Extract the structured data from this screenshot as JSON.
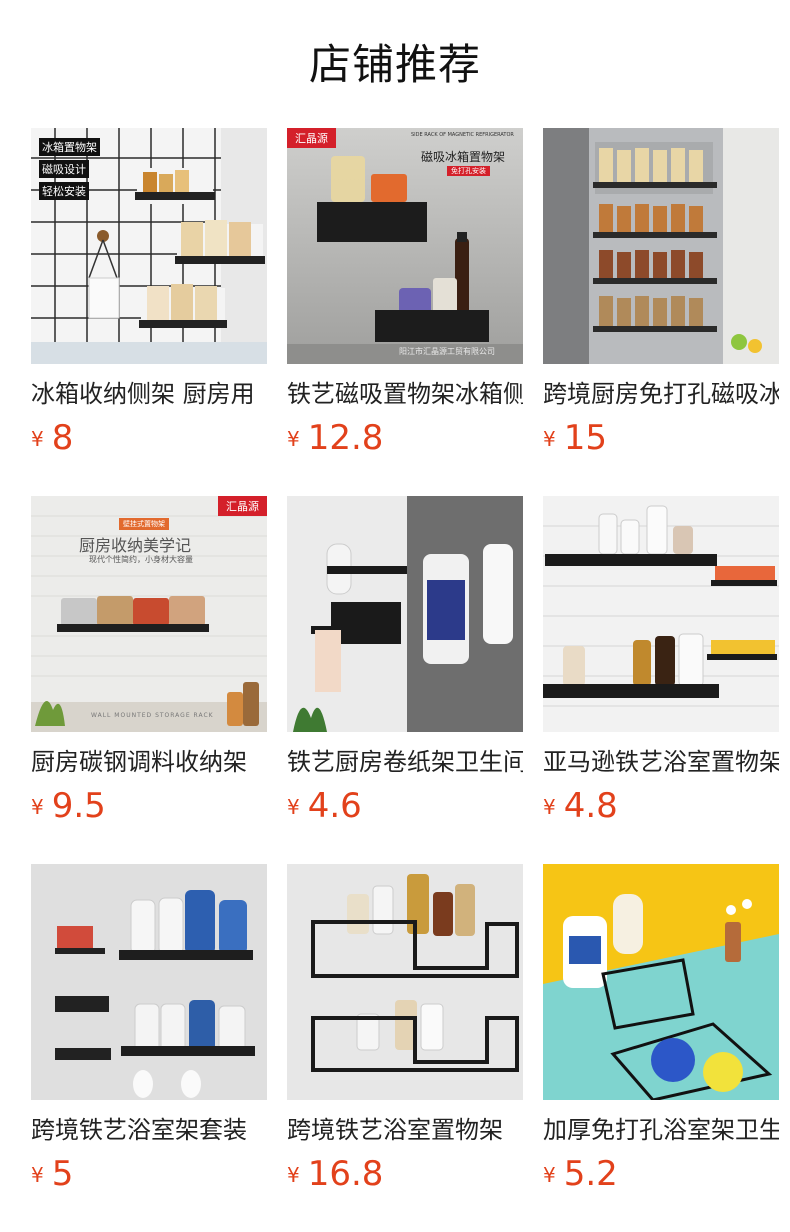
{
  "title": "店铺推荐",
  "currency": "¥",
  "products": [
    {
      "name": "冰箱收纳侧架 厨房用",
      "price": "8",
      "image_texts": [
        "冰箱置物架",
        "磁吸设计",
        "轻松安装"
      ]
    },
    {
      "name": "铁艺磁吸置物架冰箱侧",
      "price": "12.8",
      "badge": "汇晶源",
      "image_texts": [
        "SIDE RACK OF MAGNETIC REFRIGERATOR",
        "磁吸冰箱置物架",
        "免打孔安装",
        "阳江市汇晶源工贸有限公司"
      ]
    },
    {
      "name": "跨境厨房免打孔磁吸冰",
      "price": "15"
    },
    {
      "name": "厨房碳钢调料收纳架",
      "price": "9.5",
      "badge": "汇晶源",
      "image_texts": [
        "壁挂式置物架",
        "厨房收纳美学记",
        "现代个性简约，小身材大容量",
        "WALL MOUNTED STORAGE RACK"
      ]
    },
    {
      "name": "铁艺厨房卷纸架卫生间",
      "price": "4.6"
    },
    {
      "name": "亚马逊铁艺浴室置物架",
      "price": "4.8"
    },
    {
      "name": "跨境铁艺浴室架套装",
      "price": "5"
    },
    {
      "name": "跨境铁艺浴室置物架",
      "price": "16.8"
    },
    {
      "name": "加厚免打孔浴室架卫生",
      "price": "5.2"
    }
  ],
  "colors": {
    "price": "#e2411b",
    "badge": "#d4202a"
  }
}
